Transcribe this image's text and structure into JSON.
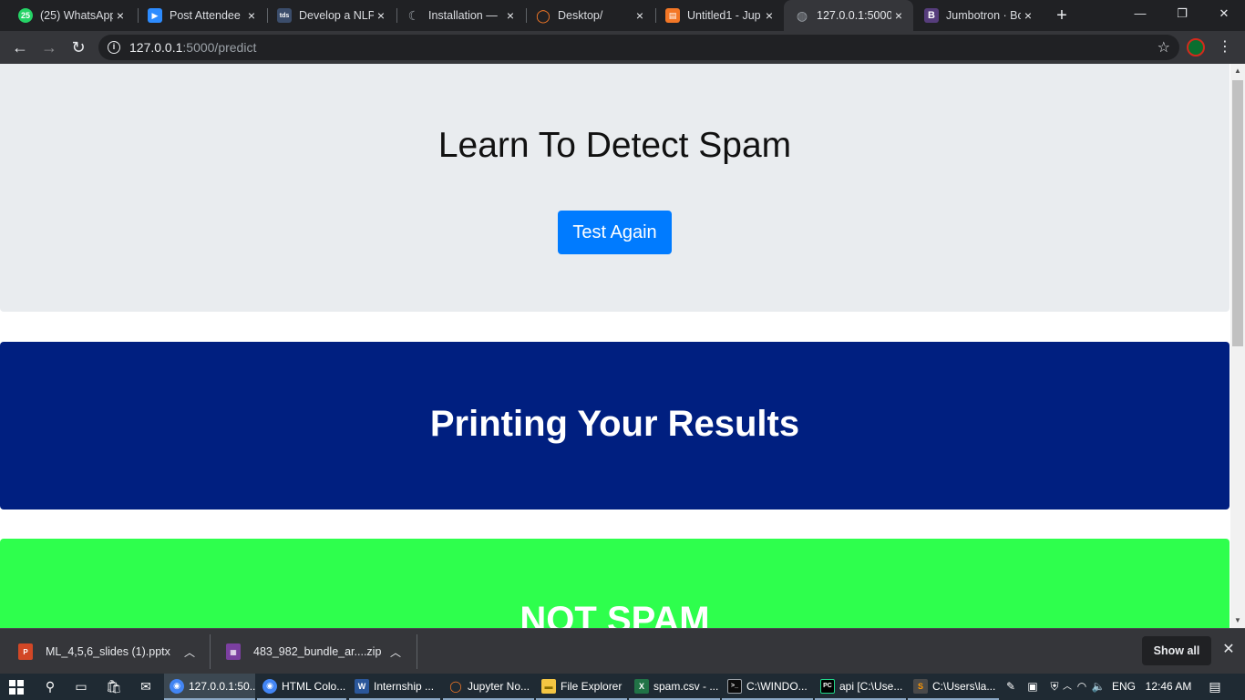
{
  "browser": {
    "tabs": [
      {
        "title": "(25) WhatsApp",
        "favicon": "whatsapp-icon",
        "color": "#25d366",
        "glyph": "25"
      },
      {
        "title": "Post Attendee",
        "favicon": "zoom-icon",
        "color": "#2d8cff",
        "glyph": "▶"
      },
      {
        "title": "Develop a NLP",
        "favicon": "tds-icon",
        "color": "#3b4d6b",
        "glyph": "tds"
      },
      {
        "title": "Installation —",
        "favicon": "moon-icon",
        "color": "#202124",
        "glyph": "☾"
      },
      {
        "title": "Desktop/",
        "favicon": "jupyter-icon",
        "color": "#f37726",
        "glyph": "◯"
      },
      {
        "title": "Untitled1 - Jup",
        "favicon": "notebook-icon",
        "color": "#f37726",
        "glyph": "▤"
      },
      {
        "title": "127.0.0.1:5000/",
        "favicon": "globe-icon",
        "color": "#5f6368",
        "glyph": "◍"
      },
      {
        "title": "Jumbotron · Bo",
        "favicon": "bootstrap-icon",
        "color": "#563d7c",
        "glyph": "B"
      }
    ],
    "new_tab_label": "+",
    "window_controls": {
      "minimize": "—",
      "maximize": "❐",
      "close": "✕"
    },
    "url_host": "127.0.0.1",
    "url_path": ":5000/predict"
  },
  "page": {
    "title": "Learn To Detect Spam",
    "button_label": "Test Again",
    "results_heading": "Printing Your Results",
    "verdict": "NOT SPAM",
    "colors": {
      "jumbotron_gray": "#e9ecef",
      "primary_blue": "#007bff",
      "results_navy": "#001f80",
      "verdict_green": "#2eff4d"
    }
  },
  "downloads": {
    "items": [
      {
        "name": "ML_4,5,6_slides (1).pptx",
        "icon": "powerpoint-icon",
        "color": "#d24726",
        "glyph": "P"
      },
      {
        "name": "483_982_bundle_ar....zip",
        "icon": "winrar-icon",
        "color": "#7b3fa0",
        "glyph": "▦"
      }
    ],
    "show_all_label": "Show all"
  },
  "taskbar": {
    "apps": [
      {
        "label": "127.0.0.1:50...",
        "icon": "chrome-icon",
        "color": "#4285f4",
        "glyph": "◉"
      },
      {
        "label": "HTML Colo...",
        "icon": "chrome-icon",
        "color": "#4285f4",
        "glyph": "◉"
      },
      {
        "label": "Internship ...",
        "icon": "word-icon",
        "color": "#2b579a",
        "glyph": "W"
      },
      {
        "label": "Jupyter No...",
        "icon": "jupyter-icon",
        "color": "#f37726",
        "glyph": "◯"
      },
      {
        "label": "File Explorer",
        "icon": "folder-icon",
        "color": "#f4c542",
        "glyph": "▬"
      },
      {
        "label": "spam.csv - ...",
        "icon": "excel-icon",
        "color": "#217346",
        "glyph": "X"
      },
      {
        "label": "C:\\WINDO...",
        "icon": "cmd-icon",
        "color": "#0c0c0c",
        "glyph": ">_"
      },
      {
        "label": "api [C:\\Use...",
        "icon": "pycharm-icon",
        "color": "#21d789",
        "glyph": "PC"
      },
      {
        "label": "C:\\Users\\la...",
        "icon": "sublime-icon",
        "color": "#ff9800",
        "glyph": "S"
      }
    ],
    "language": "ENG",
    "time": "12:46 AM"
  }
}
